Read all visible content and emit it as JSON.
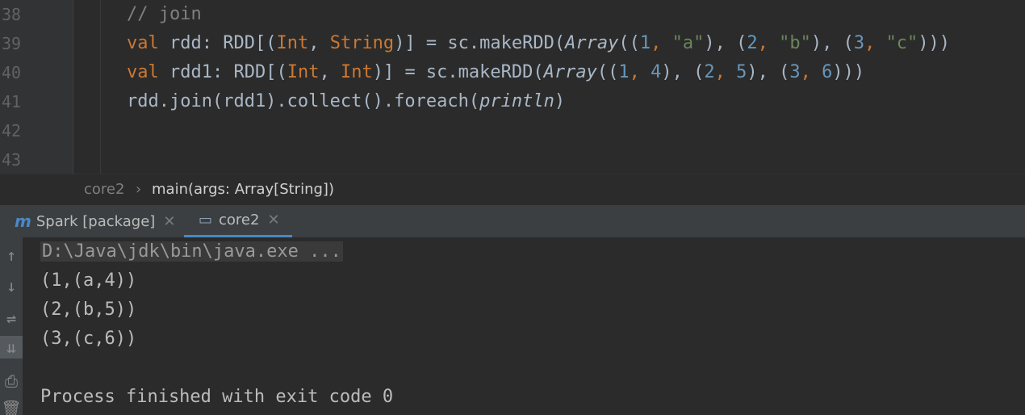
{
  "editor": {
    "line_numbers": [
      "38",
      "39",
      "40",
      "41",
      "42",
      "43"
    ],
    "comment": "// join",
    "line39": {
      "kw": "val",
      "name": " rdd: RDD[(",
      "t1": "Int",
      "sep": ", ",
      "t2": "String",
      "mid": ")] = sc.makeRDD(",
      "arr": "Array",
      "p1": "((",
      "n1": "1",
      "c1": ", ",
      "s1": "\"a\"",
      "p2": "), (",
      "n2": "2",
      "c2": ", ",
      "s2": "\"b\"",
      "p3": "), (",
      "n3": "3",
      "c3": ", ",
      "s3": "\"c\"",
      "end": ")))"
    },
    "line40": {
      "kw": "val",
      "name": " rdd1: RDD[(",
      "t1": "Int",
      "sep": ", ",
      "t2": "Int",
      "mid": ")] = sc.makeRDD(",
      "arr": "Array",
      "p1": "((",
      "n1": "1",
      "c1": ", ",
      "v1": "4",
      "p2": "), (",
      "n2": "2",
      "c2": ", ",
      "v2": "5",
      "p3": "), (",
      "n3": "3",
      "c3": ", ",
      "v3": "6",
      "end": ")))"
    },
    "line41": {
      "code": "rdd.join(rdd1).collect().foreach(",
      "fn": "println",
      "end": ")"
    }
  },
  "breadcrumb": {
    "object": "core2",
    "sep": "›",
    "method": "main(args: Array[String])"
  },
  "tabs": [
    {
      "label": "Spark [package]",
      "icon": "m"
    },
    {
      "label": "core2",
      "icon": "▭"
    }
  ],
  "console": {
    "command": "D:\\Java\\jdk\\bin\\java.exe ...",
    "lines": [
      "(1,(a,4))",
      "(2,(b,5))",
      "(3,(c,6))"
    ],
    "finished": "Process finished with exit code 0"
  },
  "tools": [
    "↑",
    "↓",
    "⇌",
    "⇊",
    "⎙",
    "🗑"
  ],
  "colors": {
    "keyword": "#cc7832",
    "string": "#6a8759",
    "number": "#6897bb",
    "text": "#a9b7c6",
    "accent": "#4a88c7"
  }
}
